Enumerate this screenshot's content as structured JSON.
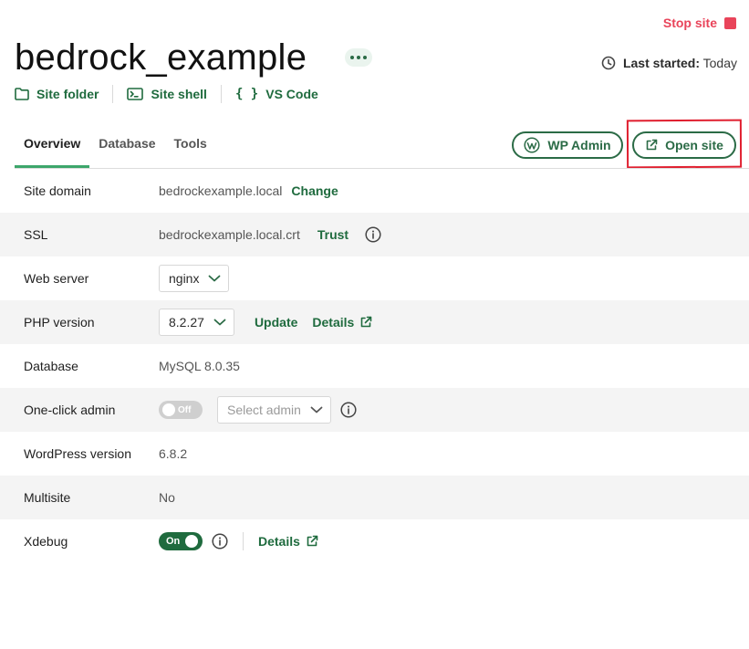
{
  "header": {
    "stop_label": "Stop site",
    "site_name": "bedrock_example",
    "last_started_label": "Last started:",
    "last_started_value": "Today"
  },
  "quick_links": [
    {
      "label": "Site folder",
      "icon": "folder-icon"
    },
    {
      "label": "Site shell",
      "icon": "terminal-icon"
    },
    {
      "label": "VS Code",
      "icon": "code-braces-icon"
    }
  ],
  "tabs": [
    {
      "label": "Overview",
      "active": true
    },
    {
      "label": "Database",
      "active": false
    },
    {
      "label": "Tools",
      "active": false
    }
  ],
  "actions": {
    "wp_admin_label": "WP Admin",
    "open_site_label": "Open site"
  },
  "overview": {
    "site_domain": {
      "label": "Site domain",
      "value": "bedrockexample.local",
      "action": "Change"
    },
    "ssl": {
      "label": "SSL",
      "value": "bedrockexample.local.crt",
      "action": "Trust"
    },
    "web_server": {
      "label": "Web server",
      "selected": "nginx"
    },
    "php_version": {
      "label": "PHP version",
      "selected": "8.2.27",
      "update": "Update",
      "details": "Details"
    },
    "database": {
      "label": "Database",
      "value": "MySQL 8.0.35"
    },
    "one_click_admin": {
      "label": "One-click admin",
      "toggle": "Off",
      "placeholder": "Select admin"
    },
    "wordpress_version": {
      "label": "WordPress version",
      "value": "6.8.2"
    },
    "multisite": {
      "label": "Multisite",
      "value": "No"
    },
    "xdebug": {
      "label": "Xdebug",
      "toggle": "On",
      "details": "Details"
    }
  },
  "colors": {
    "accent_green": "#1f6b3e",
    "tab_underline": "#3da66b",
    "stop_red": "#e9445a",
    "highlight_red": "#e01f2f"
  }
}
